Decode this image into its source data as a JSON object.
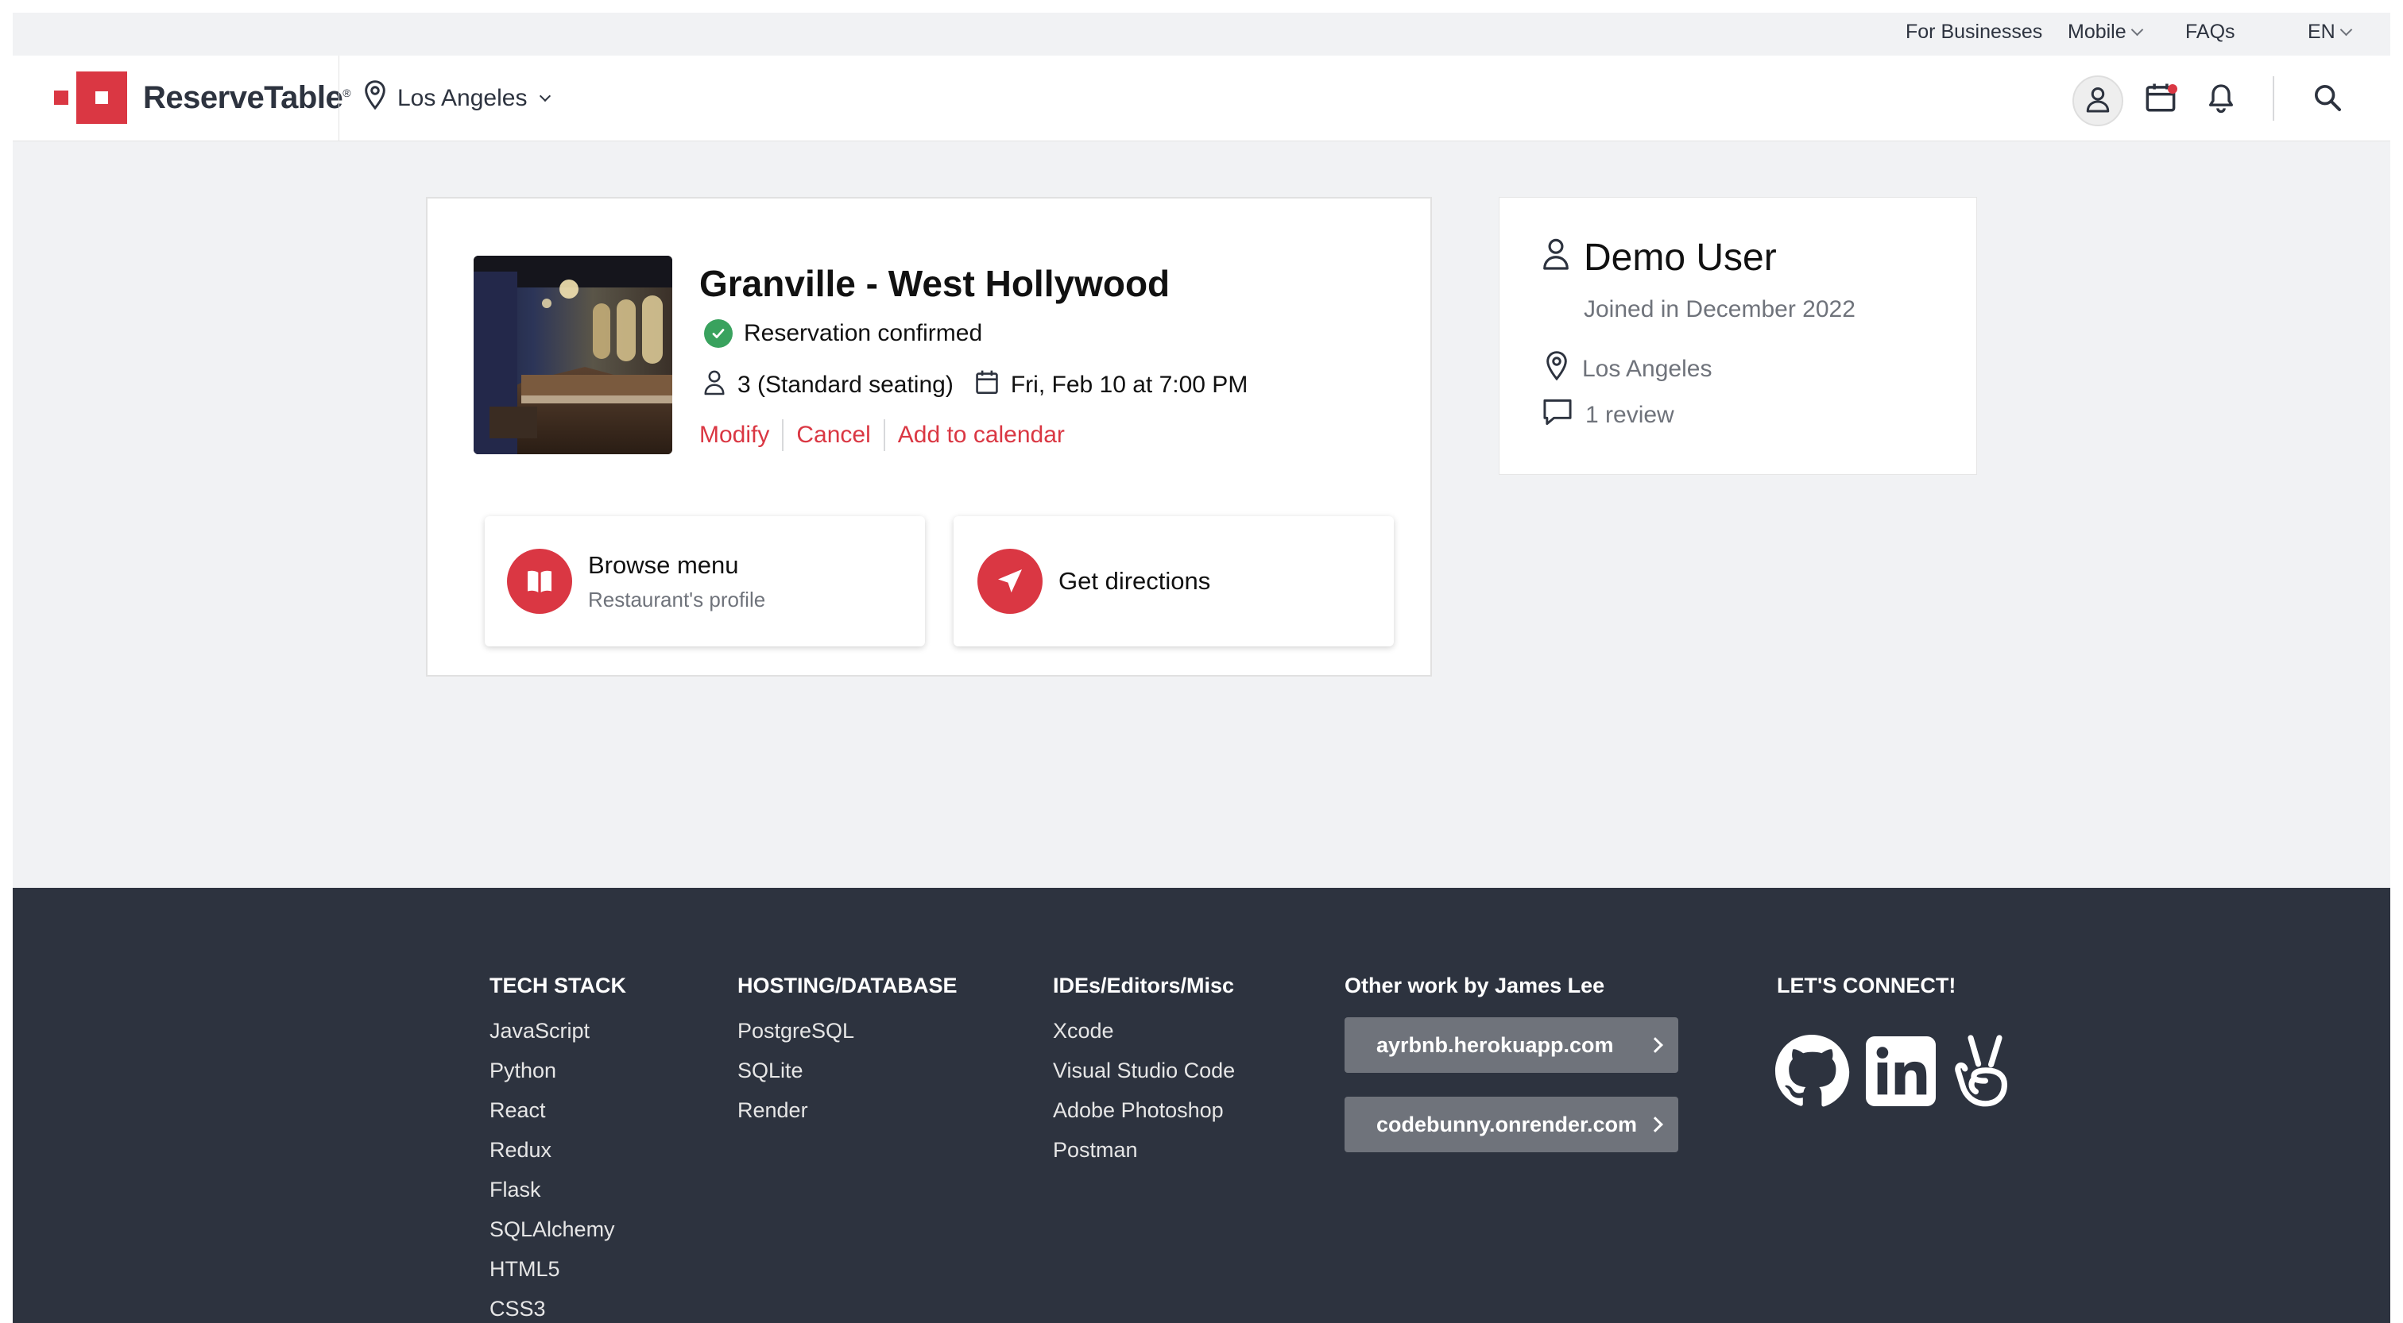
{
  "utility_bar": {
    "for_businesses": "For Businesses",
    "mobile": "Mobile",
    "faqs": "FAQs",
    "language": "EN"
  },
  "header": {
    "brand": "ReserveTable",
    "brand_mark": "®",
    "location": "Los Angeles",
    "icons": [
      "profile-icon",
      "calendar-icon",
      "bell-icon",
      "search-icon"
    ],
    "accent_color": "#da3743"
  },
  "reservation": {
    "restaurant_name": "Granville - West Hollywood",
    "status": "Reservation confirmed",
    "status_color": "#39a25e",
    "party": "3 (Standard seating)",
    "datetime": "Fri, Feb 10 at 7:00 PM",
    "actions": [
      "Modify",
      "Cancel",
      "Add to calendar"
    ],
    "tiles": {
      "browse_menu": {
        "title": "Browse menu",
        "subtitle": "Restaurant's profile"
      },
      "directions": {
        "title": "Get directions"
      }
    }
  },
  "user": {
    "name": "Demo User",
    "joined": "Joined in December 2022",
    "location": "Los Angeles",
    "reviews": "1 review"
  },
  "footer": {
    "tech_stack": {
      "heading": "TECH STACK",
      "items": [
        "JavaScript",
        "Python",
        "React",
        "Redux",
        "Flask",
        "SQLAlchemy",
        "HTML5",
        "CSS3"
      ]
    },
    "hosting": {
      "heading": "HOSTING/DATABASE",
      "items": [
        "PostgreSQL",
        "SQLite",
        "Render"
      ]
    },
    "ides": {
      "heading": "IDEs/Editors/Misc",
      "items": [
        "Xcode",
        "Visual Studio Code",
        "Adobe Photoshop",
        "Postman"
      ]
    },
    "other_work": {
      "heading": "Other work by James Lee",
      "links": [
        "ayrbnb.herokuapp.com",
        "codebunny.onrender.com"
      ]
    },
    "connect": {
      "heading": "LET'S CONNECT!",
      "icons": [
        "github-icon",
        "linkedin-icon",
        "angellist-icon"
      ]
    }
  }
}
